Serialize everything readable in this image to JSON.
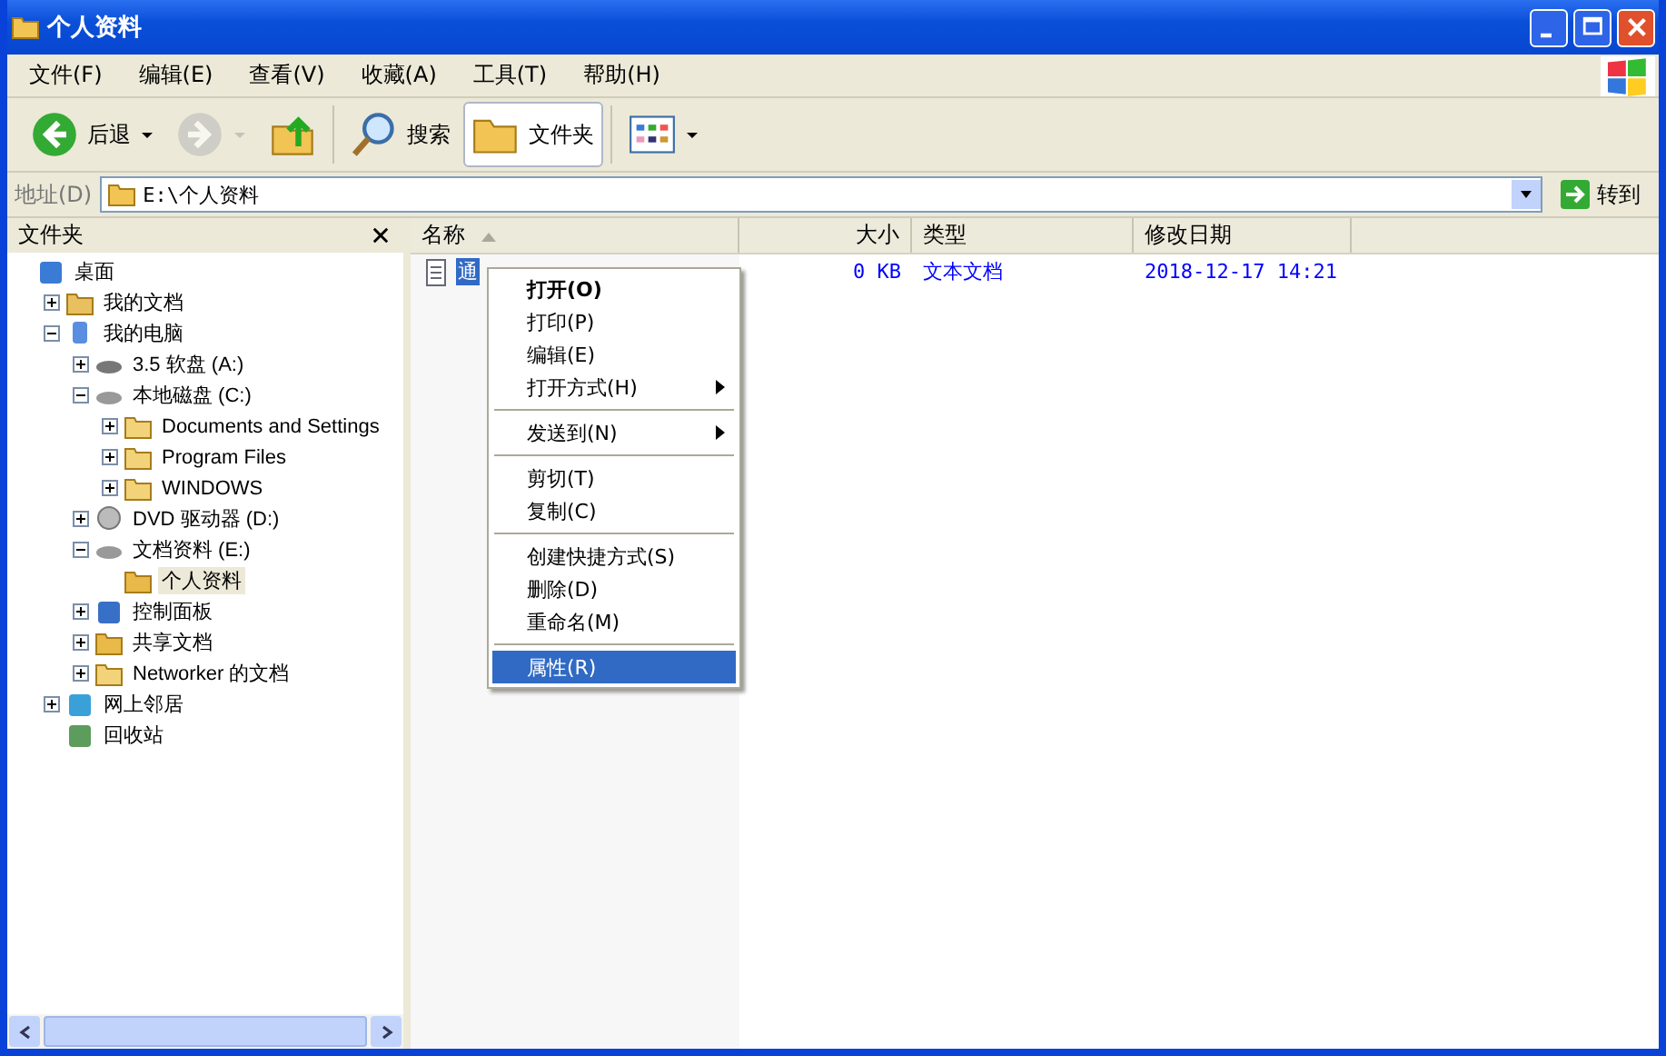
{
  "window": {
    "title": "个人资料"
  },
  "menubar": [
    "文件(F)",
    "编辑(E)",
    "查看(V)",
    "收藏(A)",
    "工具(T)",
    "帮助(H)"
  ],
  "toolbar": [
    {
      "kind": "back",
      "label": "后退",
      "disabled": false
    },
    {
      "kind": "forward",
      "disabled": true
    },
    {
      "kind": "up",
      "disabled": false
    },
    {
      "kind": "search",
      "label": "搜索",
      "disabled": false
    },
    {
      "kind": "folders",
      "label": "文件夹",
      "disabled": false,
      "selected": true
    },
    {
      "kind": "views",
      "disabled": false
    }
  ],
  "address": {
    "label": "地址(D)",
    "value": "E:\\个人资料",
    "go": "转到"
  },
  "folders_pane": {
    "title": "文件夹",
    "tree": [
      {
        "label": "桌面",
        "kind": "desktop",
        "selected": false,
        "children": [
          {
            "label": "我的文档",
            "kind": "docs",
            "expanded": false,
            "selected": false
          },
          {
            "label": "我的电脑",
            "kind": "computer",
            "expanded": true,
            "selected": false,
            "children": [
              {
                "label": "3.5 软盘 (A:)",
                "kind": "floppy",
                "expanded": false,
                "selected": false
              },
              {
                "label": "本地磁盘 (C:)",
                "kind": "drive",
                "expanded": true,
                "selected": false,
                "children": [
                  {
                    "label": "Documents and Settings",
                    "kind": "folder",
                    "expanded": false,
                    "selected": false
                  },
                  {
                    "label": "Program Files",
                    "kind": "folder",
                    "expanded": false,
                    "selected": false
                  },
                  {
                    "label": "WINDOWS",
                    "kind": "folder",
                    "expanded": false,
                    "selected": false
                  }
                ]
              },
              {
                "label": "DVD 驱动器 (D:)",
                "kind": "dvd",
                "expanded": false,
                "selected": false
              },
              {
                "label": "文档资料 (E:)",
                "kind": "drive",
                "expanded": true,
                "selected": false,
                "children": [
                  {
                    "label": "个人资料",
                    "kind": "openfolder",
                    "selected": true
                  }
                ]
              },
              {
                "label": "控制面板",
                "kind": "control",
                "expanded": false,
                "selected": false
              },
              {
                "label": "共享文档",
                "kind": "openfolder",
                "expanded": false,
                "selected": false
              },
              {
                "label": "Networker 的文档",
                "kind": "folder",
                "expanded": false,
                "selected": false
              }
            ]
          },
          {
            "label": "网上邻居",
            "kind": "network",
            "expanded": false,
            "selected": false
          },
          {
            "label": "回收站",
            "kind": "recycle",
            "selected": false
          }
        ]
      }
    ]
  },
  "list": {
    "columns": [
      {
        "label": "名称",
        "sorted": true
      },
      {
        "label": "大小",
        "sorted": false
      },
      {
        "label": "类型",
        "sorted": false
      },
      {
        "label": "修改日期",
        "sorted": false
      }
    ],
    "rows": [
      {
        "name": "通",
        "size": "0 KB",
        "type": "文本文档",
        "modified": "2018-12-17 14:21",
        "selected": true
      }
    ]
  },
  "context_menu": [
    {
      "kind": "item",
      "label": "打开(O)",
      "default": true,
      "submenu": false,
      "selected": false
    },
    {
      "kind": "item",
      "label": "打印(P)",
      "default": false,
      "submenu": false,
      "selected": false
    },
    {
      "kind": "item",
      "label": "编辑(E)",
      "default": false,
      "submenu": false,
      "selected": false
    },
    {
      "kind": "item",
      "label": "打开方式(H)",
      "default": false,
      "submenu": true,
      "selected": false
    },
    {
      "kind": "separator"
    },
    {
      "kind": "item",
      "label": "发送到(N)",
      "default": false,
      "submenu": true,
      "selected": false
    },
    {
      "kind": "separator"
    },
    {
      "kind": "item",
      "label": "剪切(T)",
      "default": false,
      "submenu": false,
      "selected": false
    },
    {
      "kind": "item",
      "label": "复制(C)",
      "default": false,
      "submenu": false,
      "selected": false
    },
    {
      "kind": "separator"
    },
    {
      "kind": "item",
      "label": "创建快捷方式(S)",
      "default": false,
      "submenu": false,
      "selected": false
    },
    {
      "kind": "item",
      "label": "删除(D)",
      "default": false,
      "submenu": false,
      "selected": false
    },
    {
      "kind": "item",
      "label": "重命名(M)",
      "default": false,
      "submenu": false,
      "selected": false
    },
    {
      "kind": "separator"
    },
    {
      "kind": "item",
      "label": "属性(R)",
      "default": false,
      "submenu": false,
      "selected": true
    }
  ]
}
